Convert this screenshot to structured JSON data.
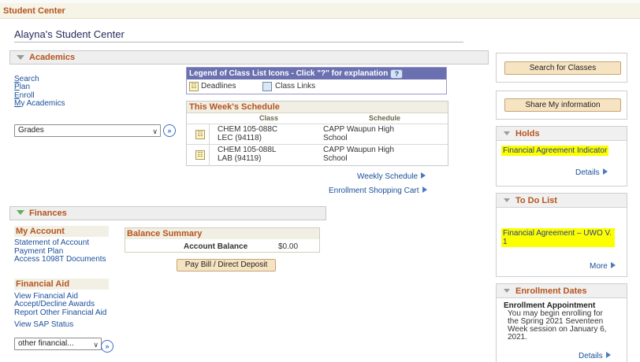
{
  "header": {
    "title": "Student Center"
  },
  "student_center_title": "Alayna's Student Center",
  "academics": {
    "section_label": "Academics",
    "links": [
      "Search",
      "Plan",
      "Enroll",
      "My Academics"
    ],
    "dropdown_value": "Grades",
    "legend": {
      "title": "Legend of Class List Icons - Click \"?\" for explanation",
      "help_label": "?",
      "deadlines": "Deadlines",
      "class_links": "Class Links"
    },
    "schedule": {
      "title": "This Week's Schedule",
      "col_class": "Class",
      "col_schedule": "Schedule",
      "rows": [
        {
          "class_line1": "CHEM 105-088C",
          "class_line2": "LEC (94118)",
          "sched_line1": "CAPP Waupun High",
          "sched_line2": "School"
        },
        {
          "class_line1": "CHEM 105-088L",
          "class_line2": "LAB (94119)",
          "sched_line1": "CAPP Waupun High",
          "sched_line2": "School"
        }
      ]
    },
    "weekly_schedule": "Weekly Schedule",
    "shopping_cart": "Enrollment Shopping Cart"
  },
  "finances": {
    "section_label": "Finances",
    "my_account_title": "My Account",
    "my_account_links": [
      "Statement of Account",
      "Payment Plan",
      "Access 1098T Documents"
    ],
    "balance": {
      "title": "Balance Summary",
      "label": "Account Balance",
      "value": "$0.00",
      "pay_button": "Pay Bill / Direct Deposit"
    },
    "financial_aid_title": "Financial Aid",
    "financial_aid_links": [
      "View Financial Aid",
      "Accept/Decline Awards",
      "Report Other Financial Aid"
    ],
    "sap_status": "View SAP Status",
    "dropdown_value": "other financial..."
  },
  "right": {
    "search_button": "Search for Classes",
    "share_button": "Share My information",
    "holds": {
      "title": "Holds",
      "item": "Financial Agreement Indicator",
      "details": "Details"
    },
    "todo": {
      "title": "To Do List",
      "item_line1": "Financial Agreement – UWO V.",
      "item_line2": "1",
      "more": "More"
    },
    "enrollment_dates": {
      "title": "Enrollment Dates",
      "subtitle": "Enrollment Appointment",
      "lines": [
        "You may begin enrolling for",
        "the Spring 2021 Seventeen",
        "Week session on January 6,",
        "2021."
      ],
      "details": "Details"
    }
  },
  "colors": {
    "accent": "#b5541e",
    "link": "#1a4f9c",
    "highlight": "#fbff00",
    "legend_header": "#6a70b0"
  },
  "icons": [
    "collapse-triangle-icon",
    "go-arrow-icon",
    "help-icon",
    "deadlines-icon",
    "class-links-icon",
    "right-arrow-icon",
    "chevron-down-icon"
  ]
}
